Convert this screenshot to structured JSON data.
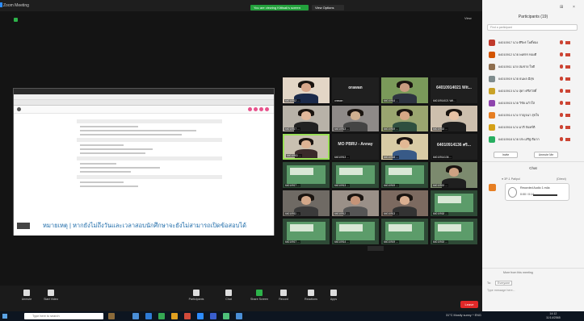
{
  "window": {
    "title": "Zoom Meeting"
  },
  "share": {
    "banner": "You are viewing Kittisak's screen",
    "options": "View Options"
  },
  "view": {
    "label": "View"
  },
  "shared_screen": {
    "subtitle": "หมายเหตุ | หากยังไม่ถึงวันและเวลาสอบนักศึกษาจะยังไม่สามารถเปิดข้อสอบได้"
  },
  "gallery": [
    {
      "type": "video",
      "label": "64010912 ...",
      "shirt": "#1b2a4a",
      "face": "#d9a78a",
      "bg": "#e3d6c6"
    },
    {
      "type": "name",
      "name": "orawan",
      "label": "orawan"
    },
    {
      "type": "video",
      "label": "64010914 ...",
      "shirt": "#2d3340",
      "face": "#c89b80",
      "bg": "#7a9a5a"
    },
    {
      "type": "name",
      "name": "64010914021 Wit...",
      "label": "64010914021 Wit..."
    },
    {
      "type": "video",
      "label": "64010917 ...",
      "shirt": "#222",
      "face": "#e2b89b",
      "bg": "#b8b2a8"
    },
    {
      "type": "video",
      "label": "64010913 ...",
      "shirt": "#444",
      "face": "#d0b090",
      "bg": "#8e8a88"
    },
    {
      "type": "video",
      "label": "64010919 ...",
      "shirt": "#2f4f3f",
      "face": "#d6a685",
      "bg": "#9aa570"
    },
    {
      "type": "video",
      "label": "64010915 ...",
      "shirt": "#1f1f1f",
      "face": "#e8c2a5",
      "bg": "#cdbfad"
    },
    {
      "type": "video",
      "label": "64010911 ...",
      "shirt": "#3a2a2a",
      "face": "#ddb394",
      "bg": "#c9c0b0",
      "active": true
    },
    {
      "type": "name",
      "name": "MO PBRU - Annay",
      "label": "64010913 ..."
    },
    {
      "type": "video",
      "label": "64010918 ...",
      "shirt": "#385a87",
      "face": "#e2b894",
      "bg": "#d8cba5"
    },
    {
      "type": "name",
      "name": "64010914136 ศริ...",
      "label": "64010914136 ..."
    },
    {
      "type": "slide",
      "label": "64010917 ..."
    },
    {
      "type": "slide",
      "label": "64010913 ..."
    },
    {
      "type": "slide",
      "label": "64010919 ..."
    },
    {
      "type": "video",
      "label": "64010915 ...",
      "shirt": "#1f1f1f",
      "face": "#cda283",
      "bg": "#7c8a6e"
    },
    {
      "type": "video",
      "label": "64010911 ...",
      "shirt": "#3a3a3a",
      "face": "#d2a789",
      "bg": "#6f6a64"
    },
    {
      "type": "video",
      "label": "64010912 ...",
      "shirt": "#555",
      "face": "#c59478",
      "bg": "#9a9088"
    },
    {
      "type": "video",
      "label": "64010913 ...",
      "shirt": "#333",
      "face": "#d9ae90",
      "bg": "#7c6a60"
    },
    {
      "type": "slide",
      "label": "64010918 ..."
    },
    {
      "type": "slide",
      "label": "64010917 ..."
    },
    {
      "type": "slide",
      "label": "64010914 ..."
    },
    {
      "type": "slide",
      "label": "64010919 ..."
    },
    {
      "type": "slide",
      "label": "64010915 ..."
    }
  ],
  "participants": {
    "header": "Participants (19)",
    "search_placeholder": "Find a participant",
    "list": [
      {
        "name": "64010917 นาง ศิริพร โพธิ์ทอง",
        "color": "#c0392b"
      },
      {
        "name": "64010912 นาย พงศกร ทองดี",
        "color": "#d35400"
      },
      {
        "name": "64010911 นาย สมชาย ใจดี",
        "color": "#8e6e4e"
      },
      {
        "name": "64010919 นาย ธนพล มีสุข",
        "color": "#7f8c8d"
      },
      {
        "name": "64010913 นาง สุดา ศรีสวัสดิ์",
        "color": "#c9a227"
      },
      {
        "name": "64010915 นาย วิชัย แก้วใส",
        "color": "#8e44ad"
      },
      {
        "name": "64010914 นาง กาญจนา สุขใจ",
        "color": "#e67e22"
      },
      {
        "name": "64010916 นาง มาลี จันทร์ดี",
        "color": "#d4a017"
      },
      {
        "name": "64010918 นาย ประเสริฐ ดีมาก",
        "color": "#27ae60"
      }
    ],
    "invite": "Invite",
    "unmute_all": "Unmute Me"
  },
  "chat": {
    "header": "Chat",
    "from": "● 3P-1 Patipol",
    "to": "(Direct)",
    "audio_title": "Recorded Audio 1.m4a",
    "audio_time": "0:00 / 0:14",
    "more_files": "More from this meeting",
    "to_label": "To:",
    "to_value": "Everyone",
    "placeholder": "Type message here..."
  },
  "toolbar": {
    "items": [
      {
        "label": "Unmute",
        "green": false
      },
      {
        "label": "Start Video",
        "green": false
      },
      {
        "label": "Participants",
        "green": false
      },
      {
        "label": "Chat",
        "green": false
      },
      {
        "label": "Share Screen",
        "green": true
      },
      {
        "label": "Record",
        "green": false
      },
      {
        "label": "Reactions",
        "green": false
      },
      {
        "label": "Apps",
        "green": false
      }
    ],
    "leave": "Leave"
  },
  "taskbar": {
    "search": "Type here to search",
    "tray": "31°C  Mostly sunny  ^  ENG",
    "time": "14:12",
    "date": "11/14/2565"
  }
}
